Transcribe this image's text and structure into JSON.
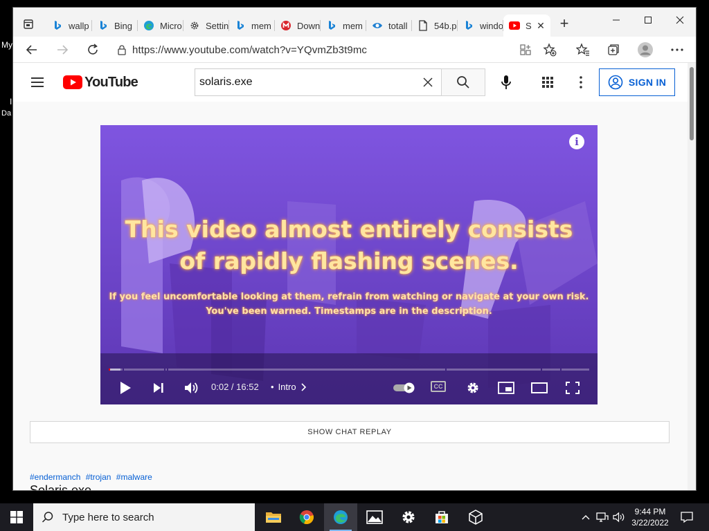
{
  "desktop": {
    "left_text_top": "My",
    "left_text_mid": "I",
    "left_text_bottom": "Da"
  },
  "browser": {
    "tabs": [
      {
        "title": "wallp",
        "icon": "bing-icon"
      },
      {
        "title": "Bing",
        "icon": "bing-icon"
      },
      {
        "title": "Micro",
        "icon": "edge-icon"
      },
      {
        "title": "Settin",
        "icon": "gear-icon"
      },
      {
        "title": "mem",
        "icon": "bing-icon"
      },
      {
        "title": "Down",
        "icon": "mega-icon"
      },
      {
        "title": "mem",
        "icon": "bing-icon"
      },
      {
        "title": "totall",
        "icon": "totalav-icon"
      },
      {
        "title": "54b.p",
        "icon": "file-icon"
      },
      {
        "title": "windo",
        "icon": "bing-icon"
      },
      {
        "title": "S",
        "icon": "youtube-icon",
        "active": true
      }
    ],
    "url": "https://www.youtube.com/watch?v=YQvmZb3t9mc"
  },
  "youtube": {
    "logo_text": "YouTube",
    "search_value": "solaris.exe",
    "sign_in_label": "SIGN IN",
    "brand_red": "#ff0000",
    "link_blue": "#065fd4"
  },
  "player": {
    "warning_line1": "This video almost entirely consists",
    "warning_line2": "of rapidly flashing scenes.",
    "subtext_line1": "If you feel uncomfortable looking at them, refrain from watching or navigate at your own risk.",
    "subtext_line2": "You've been warned. Timestamps are in the description.",
    "info_label": "i",
    "time_current": "0:02",
    "time_total": "16:52",
    "time_display": "0:02 / 16:52",
    "chapter_bullet": "•",
    "chapter": "Intro",
    "cc_label": "CC",
    "progress_fraction": 0.002,
    "buffered_fraction": 0.025
  },
  "page": {
    "chat_replay_label": "SHOW CHAT REPLAY",
    "hashtags": [
      "#endermanch",
      "#trojan",
      "#malware"
    ],
    "video_title": "Solaris.exe"
  },
  "taskbar": {
    "search_placeholder": "Type here to search",
    "time": "9:44 PM",
    "date": "3/22/2022"
  }
}
